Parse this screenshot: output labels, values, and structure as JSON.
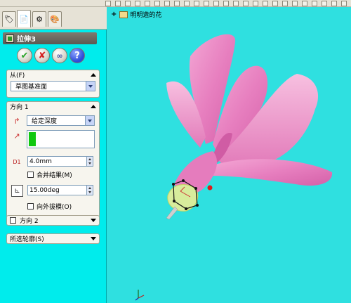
{
  "feature": {
    "title": "拉伸3"
  },
  "buttons": {
    "ok": "✔",
    "cancel": "✘",
    "preview": "∞",
    "help": "?"
  },
  "from_group": {
    "label": "从(F)",
    "value": "草图基准面"
  },
  "direction1": {
    "label": "方向 1",
    "end_condition": "给定深度",
    "depth": "4.0mm",
    "merge_label": "合并结果(M)",
    "draft_angle": "15.00deg",
    "draft_outward_label": "向外拔模(O)",
    "depth_icon_caption": "D1"
  },
  "direction2": {
    "label": "方向 2"
  },
  "selected_contours": {
    "label": "所选轮廓(S)"
  },
  "viewport": {
    "part_name": "明明造的花",
    "plus": "+"
  },
  "colors": {
    "background": "#2fe0e0",
    "petal": "#e97fbf",
    "panel": "#00ecec"
  }
}
